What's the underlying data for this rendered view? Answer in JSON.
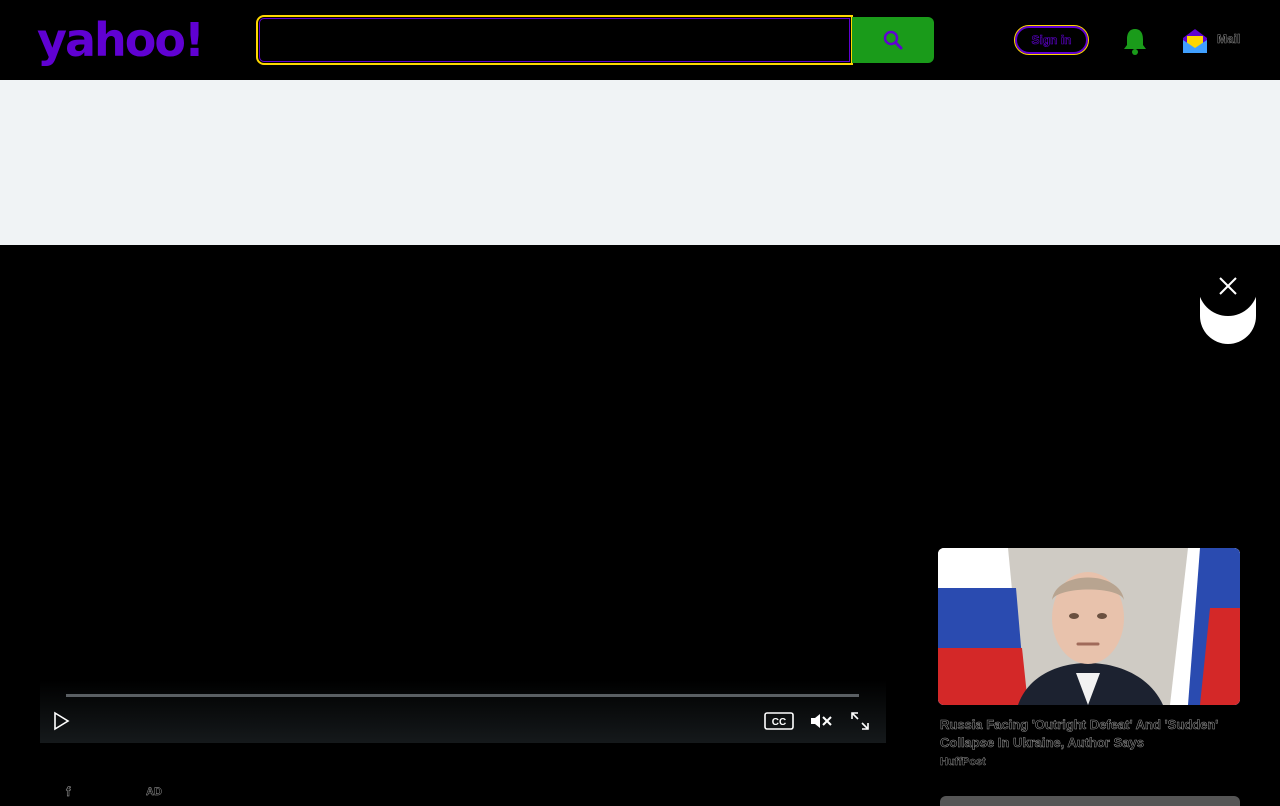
{
  "header": {
    "logo_text": "yahoo!",
    "search_placeholder": "",
    "signin_label": "Sign in",
    "mail_label": "Mail"
  },
  "player": {
    "progress": 0,
    "muted": true
  },
  "side_card": {
    "title": "Russia Facing 'Outright Defeat' And 'Sudden' Collapse In Ukraine, Author Says",
    "source": "HuffPost"
  },
  "footer": {
    "share_label": "f",
    "ad_label": "AD"
  },
  "colors": {
    "brand": "#6001d2",
    "search_button": "#1a9b1a",
    "focus": "#ffd700",
    "ad_band": "#f0f3f5"
  }
}
